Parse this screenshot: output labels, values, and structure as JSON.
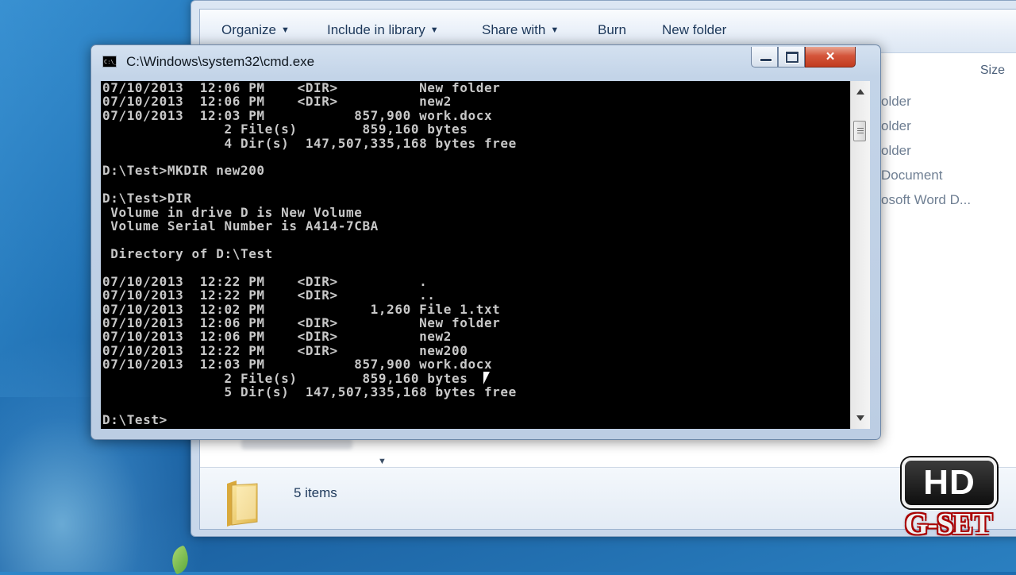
{
  "explorer": {
    "toolbar": {
      "organize": "Organize",
      "include_in_library": "Include in library",
      "share_with": "Share with",
      "burn": "Burn",
      "new_folder": "New folder"
    },
    "columns": {
      "size": "Size"
    },
    "right_items": [
      "older",
      "older",
      "older",
      "Document",
      "osoft Word D..."
    ],
    "details": {
      "items_count": "5 items"
    }
  },
  "cmd": {
    "title": "C:\\Windows\\system32\\cmd.exe",
    "icon_text": "C:\\_",
    "console_lines": [
      "07/10/2013  12:06 PM    <DIR>          New folder",
      "07/10/2013  12:06 PM    <DIR>          new2",
      "07/10/2013  12:03 PM           857,900 work.docx",
      "               2 File(s)        859,160 bytes",
      "               4 Dir(s)  147,507,335,168 bytes free",
      "",
      "D:\\Test>MKDIR new200",
      "",
      "D:\\Test>DIR",
      " Volume in drive D is New Volume",
      " Volume Serial Number is A414-7CBA",
      "",
      " Directory of D:\\Test",
      "",
      "07/10/2013  12:22 PM    <DIR>          .",
      "07/10/2013  12:22 PM    <DIR>          ..",
      "07/10/2013  12:02 PM             1,260 File 1.txt",
      "07/10/2013  12:06 PM    <DIR>          New folder",
      "07/10/2013  12:06 PM    <DIR>          new2",
      "07/10/2013  12:22 PM    <DIR>          new200",
      "07/10/2013  12:03 PM           857,900 work.docx",
      "               2 File(s)        859,160 bytes",
      "               5 Dir(s)  147,507,335,168 bytes free",
      "",
      "D:\\Test>"
    ],
    "buttons": {
      "close": "×"
    }
  },
  "watermark": {
    "hd": "HD",
    "gset": "G-SET"
  },
  "colors": {
    "desktop": "#1d6fb3",
    "console_bg": "#000000",
    "console_fg": "#c8c8c8",
    "close_button": "#c13c1f"
  }
}
